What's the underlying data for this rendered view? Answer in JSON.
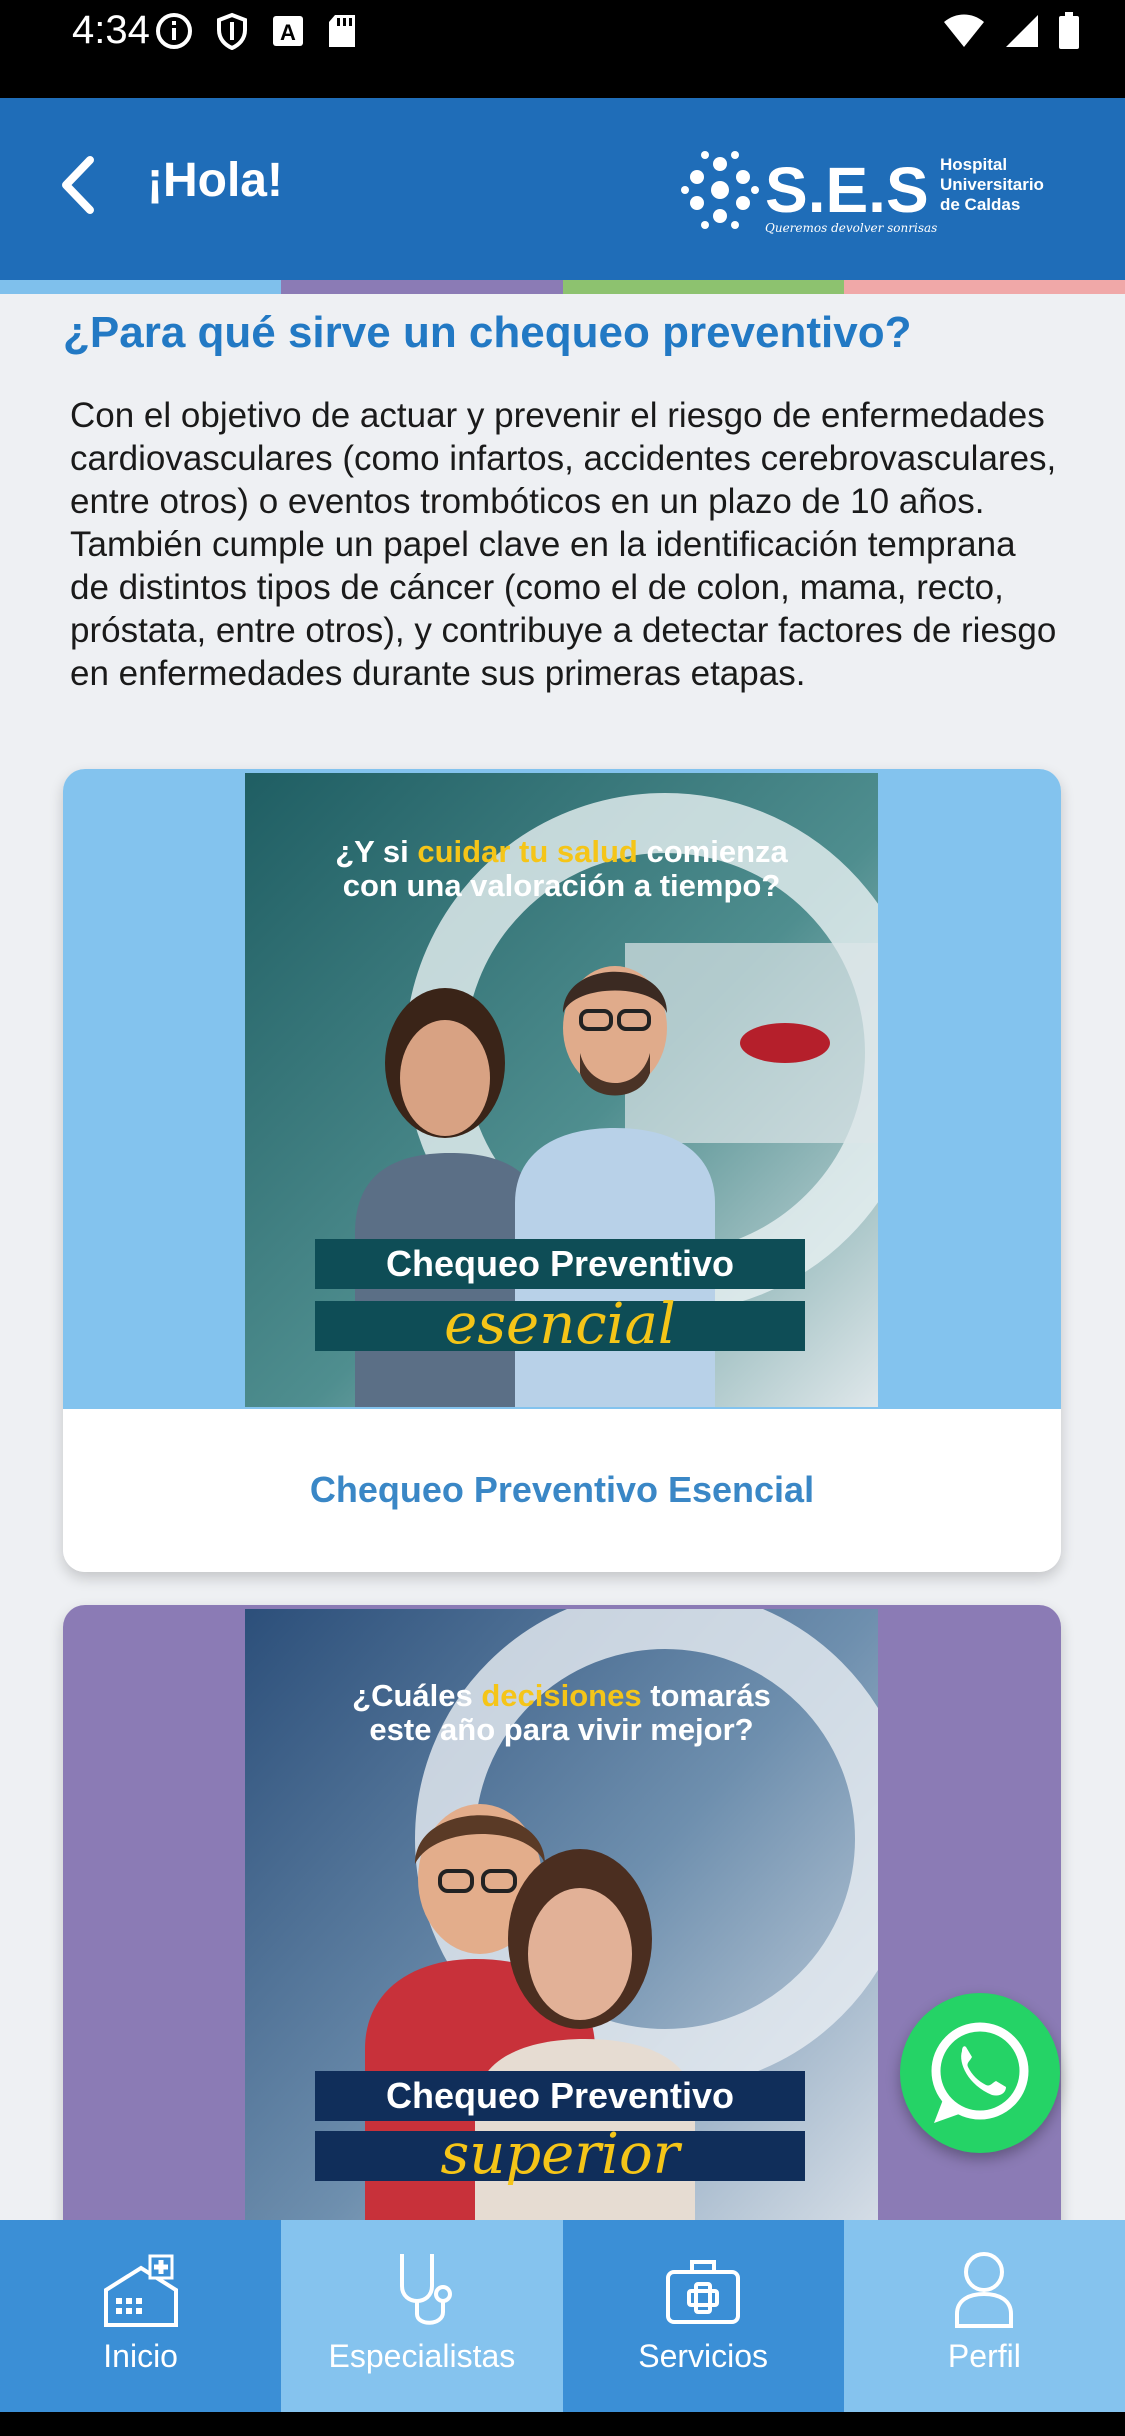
{
  "status_bar": {
    "time": "4:34",
    "icons": [
      "info-icon",
      "shield-icon",
      "a-icon",
      "sd-card-icon",
      "wifi-icon",
      "signal-icon",
      "battery-icon"
    ]
  },
  "header": {
    "title": "¡Hola!",
    "logo": {
      "brand": "S.E.S",
      "line1": "Hospital",
      "line2": "Universitario",
      "line3": "de Caldas",
      "tagline": "Queremos devolver sonrisas"
    },
    "strip_colors": [
      "#7fc0ec",
      "#8b7bb5",
      "#8dc26f",
      "#f0a8a8"
    ]
  },
  "content": {
    "section_title": "¿Para qué sirve un chequeo preventivo?",
    "body_text": "Con el objetivo de actuar y prevenir el riesgo de enfermedades cardiovasculares (como infartos, accidentes cerebrovasculares, entre otros) o eventos trombóticos en un plazo de 10 años. También cumple un papel clave en la identificación temprana de distintos tipos de cáncer (como el de colon, mama, recto, próstata, entre otros), y contribuye a detectar factores de riesgo en enfermedades durante sus primeras etapas.",
    "cards": [
      {
        "promo_q_start": "¿Y si ",
        "promo_q_highlight": "cuidar tu salud",
        "promo_q_end": " comienza",
        "promo_q_line2": "con una valoración a tiempo?",
        "promo_badge_title": "Chequeo Preventivo",
        "promo_badge_script": "esencial",
        "label": "Chequeo Preventivo Esencial"
      },
      {
        "promo_q_start": "¿Cuáles ",
        "promo_q_highlight": "decisiones",
        "promo_q_end": " tomarás",
        "promo_q_line2": "este año para vivir mejor?",
        "promo_badge_title": "Chequeo Preventivo",
        "promo_badge_script": "superior",
        "label": ""
      }
    ]
  },
  "fab": {
    "icon": "whatsapp-icon"
  },
  "bottom_nav": [
    {
      "label": "Inicio",
      "icon": "hospital-icon"
    },
    {
      "label": "Especialistas",
      "icon": "stethoscope-icon"
    },
    {
      "label": "Servicios",
      "icon": "medical-kit-icon"
    },
    {
      "label": "Perfil",
      "icon": "user-icon"
    }
  ]
}
